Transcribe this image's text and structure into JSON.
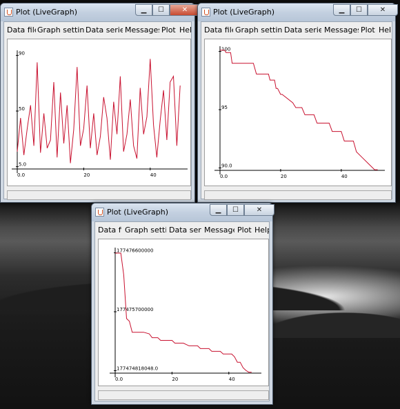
{
  "windows": [
    {
      "id": "w1",
      "title": "Plot (LiveGraph)",
      "menu": [
        "Data file",
        "Graph settings",
        "Data series",
        "Messages",
        "Plot",
        "Help"
      ],
      "chart_data": {
        "type": "line",
        "x": [
          0,
          1,
          2,
          3,
          4,
          5,
          6,
          7,
          8,
          9,
          10,
          11,
          12,
          13,
          14,
          15,
          16,
          17,
          18,
          19,
          20,
          21,
          22,
          23,
          24,
          25,
          26,
          27,
          28,
          29,
          30,
          31,
          32,
          33,
          34,
          35,
          36,
          37,
          38,
          39,
          40,
          41,
          42,
          43,
          44,
          45,
          46,
          47,
          48,
          49
        ],
        "values": [
          15,
          44,
          12,
          35,
          55,
          20,
          92,
          14,
          48,
          18,
          25,
          75,
          10,
          66,
          22,
          55,
          5,
          34,
          88,
          20,
          35,
          72,
          18,
          48,
          12,
          28,
          62,
          44,
          8,
          58,
          30,
          80,
          15,
          30,
          60,
          20,
          9,
          70,
          30,
          45,
          95,
          38,
          10,
          42,
          68,
          25,
          75,
          80,
          20,
          72
        ],
        "xticks": [
          "0.0",
          "20",
          "40"
        ],
        "yticks": [
          "5.0",
          "50",
          "90"
        ],
        "xlim": [
          0,
          50
        ],
        "ylim": [
          0,
          100
        ],
        "color": "#c8102e"
      }
    },
    {
      "id": "w2",
      "title": "Plot (LiveGraph)",
      "menu": [
        "Data file",
        "Graph settings",
        "Data series",
        "Messages",
        "Plot",
        "Help"
      ],
      "chart_data": {
        "type": "line",
        "x": [
          0,
          1.5,
          2,
          3.5,
          4,
          11,
          12,
          16,
          16.5,
          18,
          18.5,
          19,
          20,
          20.5,
          24,
          25,
          27,
          28,
          31,
          32,
          36,
          37,
          40,
          41,
          44,
          45,
          47,
          49,
          51,
          52
        ],
        "values": [
          100,
          100,
          99.8,
          99.8,
          98.9,
          98.9,
          98.0,
          98.0,
          97.5,
          97.5,
          96.8,
          96.8,
          96.3,
          96.3,
          95.6,
          95.2,
          95.2,
          94.6,
          94.6,
          93.9,
          93.9,
          93.2,
          93.2,
          92.4,
          92.4,
          91.5,
          91.0,
          90.5,
          90.0,
          90.0
        ],
        "xticks": [
          "0.0",
          "20",
          "40"
        ],
        "yticks": [
          "90.0",
          "95",
          "100"
        ],
        "xlim": [
          0,
          53
        ],
        "ylim": [
          89.95,
          100.1
        ],
        "color": "#c8102e"
      }
    },
    {
      "id": "w3",
      "title": "Plot (LiveGraph)",
      "menu": [
        "Data file",
        "Graph settings",
        "Data series",
        "Messages",
        "Plot",
        "Help"
      ],
      "chart_data": {
        "type": "line",
        "x": [
          0,
          2,
          3,
          4,
          5,
          6,
          10,
          12,
          13,
          15,
          16,
          20,
          21,
          24,
          26,
          29,
          30,
          33,
          34,
          37,
          38,
          41,
          42,
          43,
          44,
          45,
          46,
          47,
          48
        ],
        "values": [
          177476600000,
          177476600000,
          177476200000,
          177475400000,
          177475350000,
          177475150000,
          177475150000,
          177475120000,
          177475050000,
          177475050000,
          177475000000,
          177475000000,
          177474950000,
          177474950000,
          177474900000,
          177474900000,
          177474850000,
          177474850000,
          177474800000,
          177474800000,
          177474750000,
          177474750000,
          177474700000,
          177474600000,
          177474600000,
          177474500000,
          177474450000,
          177474418048,
          177474418048
        ],
        "xticks": [
          "0.0",
          "20",
          "40"
        ],
        "yticks": [
          "177474818048.0",
          "177475700000",
          "177476600000"
        ],
        "xlim": [
          0,
          50
        ],
        "ylim": [
          177474400000,
          177476650000
        ],
        "color": "#c8102e"
      }
    }
  ]
}
